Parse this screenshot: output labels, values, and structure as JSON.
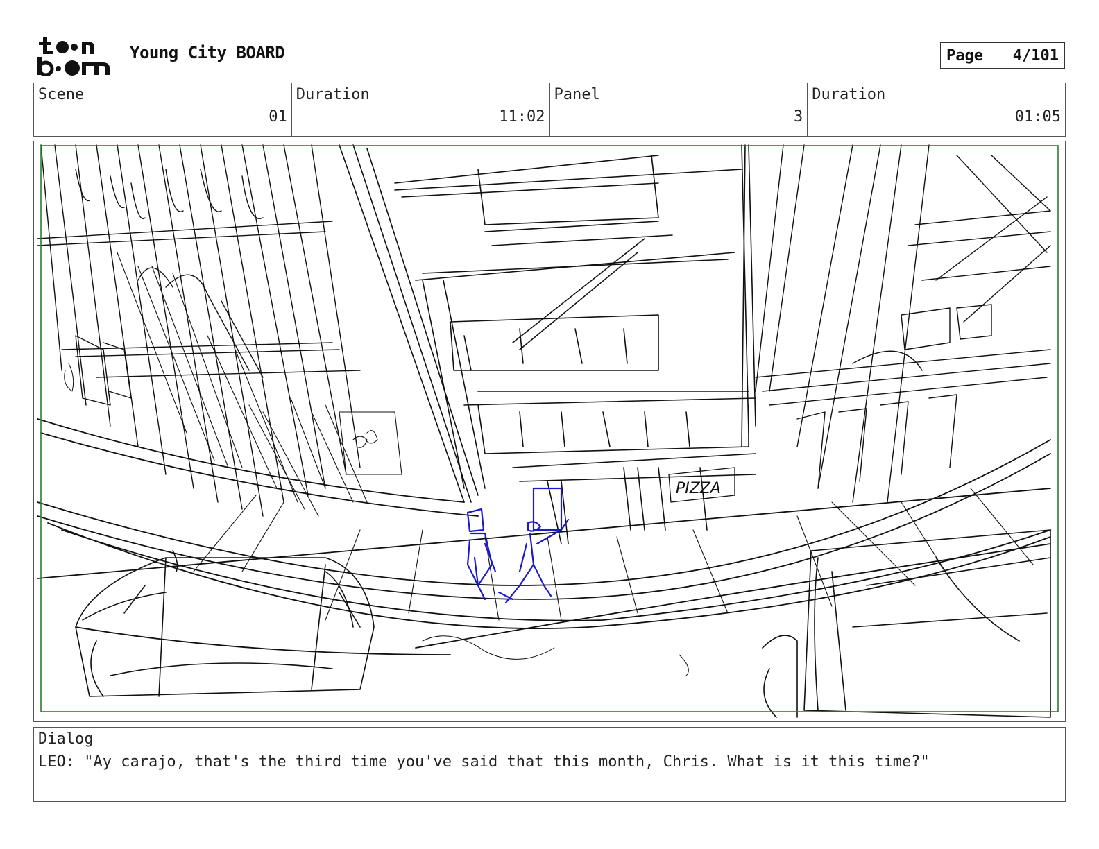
{
  "header": {
    "logo": {
      "icon": "toon-boom-logo",
      "text": "toon boom"
    },
    "title": "Young City BOARD",
    "page_label": "Page",
    "page_value": "4/101"
  },
  "info": {
    "scene_label": "Scene",
    "scene_value": "01",
    "scene_duration_label": "Duration",
    "scene_duration_value": "11:02",
    "panel_label": "Panel",
    "panel_value": "3",
    "panel_duration_label": "Duration",
    "panel_duration_value": "01:05"
  },
  "panel": {
    "image": "storyboard-sketch-city-street",
    "sign_text": "PIZZA",
    "colors": {
      "frame": "#2e7d32",
      "sketch": "#111111",
      "characters": "#1a1acc"
    }
  },
  "dialog": {
    "label": "Dialog",
    "text": "LEO: \"Ay carajo, that's the third time you've said that this month, Chris. What is it this time?\""
  }
}
